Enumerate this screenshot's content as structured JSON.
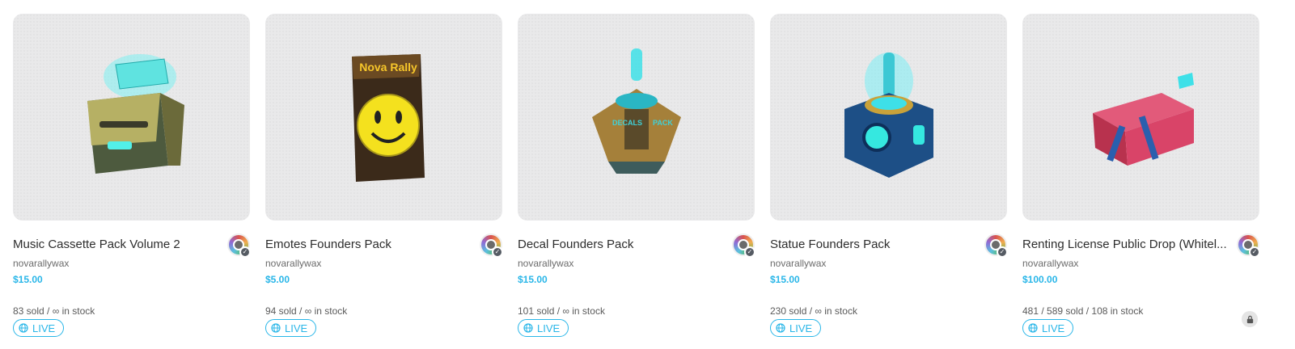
{
  "colors": {
    "accent": "#29b6e8",
    "thumb_bg": "#e9e9ea"
  },
  "cards": [
    {
      "title": "Music Cassette Pack Volume 2",
      "creator": "novarallywax",
      "price": "$15.00",
      "stock": "83 sold / ∞ in stock",
      "status": "LIVE",
      "image": "cassette-pack-image"
    },
    {
      "title": "Emotes Founders Pack",
      "creator": "novarallywax",
      "price": "$5.00",
      "stock": "94 sold / ∞ in stock",
      "status": "LIVE",
      "image": "emotes-pack-image"
    },
    {
      "title": "Decal Founders Pack",
      "creator": "novarallywax",
      "price": "$15.00",
      "stock": "101 sold / ∞ in stock",
      "status": "LIVE",
      "image": "decal-pack-image"
    },
    {
      "title": "Statue Founders Pack",
      "creator": "novarallywax",
      "price": "$15.00",
      "stock": "230 sold / ∞ in stock",
      "status": "LIVE",
      "image": "statue-pack-image"
    },
    {
      "title": "Renting License Public Drop (Whitel...",
      "creator": "novarallywax",
      "price": "$100.00",
      "stock": "481 / 589 sold / 108 in stock",
      "status": "LIVE",
      "image": "renting-license-image",
      "locked": true
    }
  ]
}
